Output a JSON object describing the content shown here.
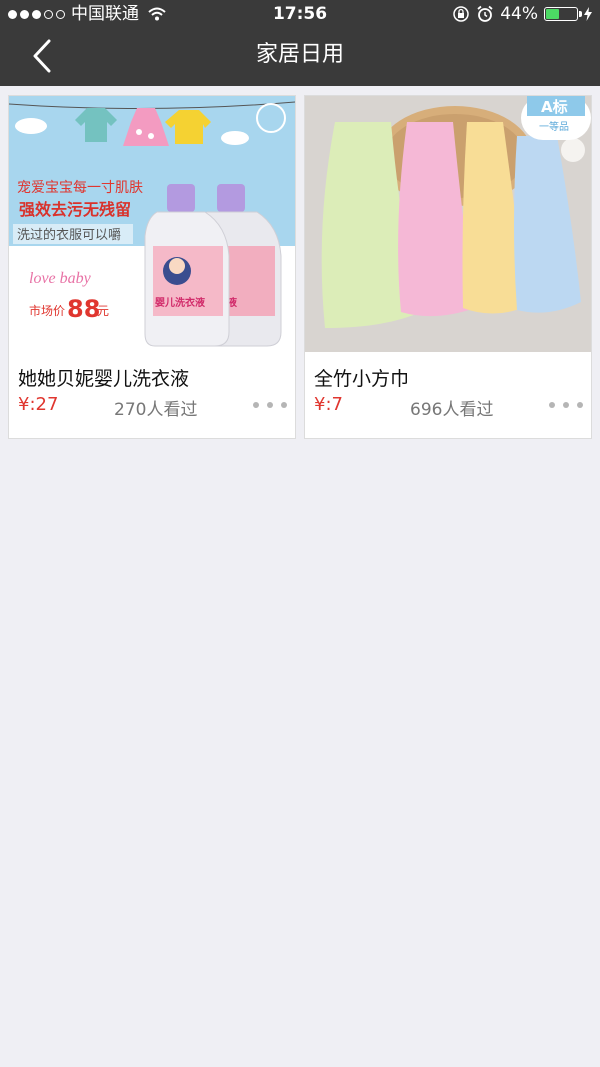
{
  "status_bar": {
    "carrier": "中国联通",
    "time": "17:56",
    "battery_text": "44%",
    "battery_level": 0.44
  },
  "nav": {
    "title": "家居日用"
  },
  "products": [
    {
      "name": "她她贝妮婴儿洗衣液",
      "price": "¥:27",
      "views": "270人看过",
      "image": {
        "line1": "宠爱宝宝每一寸肌肤",
        "line2": "强效去污无残留",
        "line3": "洗过的衣服可以嚼",
        "brand": "love baby",
        "market_label": "市场价",
        "market_price": "88",
        "market_unit": "元",
        "bottle_label": "婴儿洗衣液"
      }
    },
    {
      "name": "全竹小方巾",
      "price": "¥:7",
      "views": "696人看过",
      "image": {
        "badge_top": "A标",
        "badge_bottom": "一等品"
      }
    }
  ],
  "colors": {
    "bar": "#3a3a3a",
    "price": "#e0362f",
    "background": "#efeff4"
  }
}
